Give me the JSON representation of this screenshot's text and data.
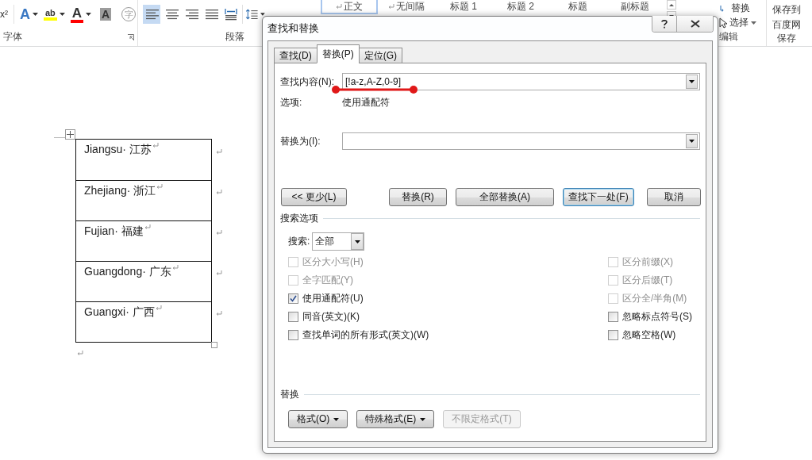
{
  "ribbon": {
    "font_group": {
      "label": "字体",
      "superscript": "x²",
      "tools": [
        {
          "kind": "text-effect",
          "glyph": "A"
        },
        {
          "kind": "highlight",
          "glyph": "ab"
        },
        {
          "kind": "font-color",
          "glyph": "A"
        },
        {
          "kind": "shading",
          "glyph": "A"
        },
        {
          "kind": "enclose",
          "glyph": "字"
        }
      ]
    },
    "paragraph_group": {
      "label": "段落",
      "tools": [
        {
          "kind": "align-left",
          "selected": true
        },
        {
          "kind": "align-center",
          "selected": false
        },
        {
          "kind": "align-right",
          "selected": false
        },
        {
          "kind": "justify",
          "selected": false
        },
        {
          "kind": "distribute",
          "selected": false
        },
        {
          "kind": "line-spacing",
          "selected": false
        }
      ]
    },
    "styles": [
      {
        "label": "正文",
        "paragraph_mark": true,
        "selected": true
      },
      {
        "label": "无间隔",
        "paragraph_mark": true,
        "selected": false
      },
      {
        "label": "标题 1",
        "paragraph_mark": false,
        "selected": false
      },
      {
        "label": "标题 2",
        "paragraph_mark": false,
        "selected": false
      },
      {
        "label": "标题",
        "paragraph_mark": false,
        "selected": false
      },
      {
        "label": "副标题",
        "paragraph_mark": false,
        "selected": false
      }
    ],
    "editing": {
      "replace": "替换",
      "select": "选择",
      "label": "编辑"
    },
    "save": {
      "line1": "保存到",
      "line2": "百度网",
      "label": "保存"
    }
  },
  "document": {
    "table": [
      {
        "text": "Jiangsu· 江苏"
      },
      {
        "text": "Zhejiang· 浙江"
      },
      {
        "text": "Fujian· 福建"
      },
      {
        "text": "Guangdong· 广东"
      },
      {
        "text": "Guangxi· 广西"
      }
    ]
  },
  "dialog": {
    "title": "查找和替换",
    "tabs": [
      {
        "label": "查找(D)",
        "selected": false
      },
      {
        "label": "替换(P)",
        "selected": true
      },
      {
        "label": "定位(G)",
        "selected": false
      }
    ],
    "find": {
      "label": "查找内容(N):",
      "value": "[!a-z,A-Z,0-9]"
    },
    "options": {
      "label": "选项:",
      "value": "使用通配符"
    },
    "replace": {
      "label": "替换为(I):"
    },
    "buttons": [
      {
        "label": "<< 更少(L)",
        "default": false
      },
      {
        "label": "替换(R)",
        "default": false
      },
      {
        "label": "全部替换(A)",
        "default": false
      },
      {
        "label": "查找下一处(F)",
        "default": true
      },
      {
        "label": "取消",
        "default": false
      }
    ],
    "search_options": {
      "title": "搜索选项",
      "search_label": "搜索:",
      "search_value": "全部",
      "left": [
        {
          "label": "区分大小写(H)",
          "checked": false,
          "disabled": true
        },
        {
          "label": "全字匹配(Y)",
          "checked": false,
          "disabled": true
        },
        {
          "label": "使用通配符(U)",
          "checked": true,
          "disabled": false
        },
        {
          "label": "同音(英文)(K)",
          "checked": false,
          "disabled": false
        },
        {
          "label": "查找单词的所有形式(英文)(W)",
          "checked": false,
          "disabled": false
        }
      ],
      "right": [
        {
          "label": "区分前缀(X)",
          "checked": false,
          "disabled": true
        },
        {
          "label": "区分后缀(T)",
          "checked": false,
          "disabled": true
        },
        {
          "label": "区分全/半角(M)",
          "checked": false,
          "disabled": true
        },
        {
          "label": "忽略标点符号(S)",
          "checked": false,
          "disabled": false
        },
        {
          "label": "忽略空格(W)",
          "checked": false,
          "disabled": false
        }
      ]
    },
    "replace_section": {
      "title": "替换",
      "buttons": [
        {
          "label": "格式(O)",
          "dropdown": true,
          "disabled": false
        },
        {
          "label": "特殊格式(E)",
          "dropdown": true,
          "disabled": false
        },
        {
          "label": "不限定格式(T)",
          "dropdown": false,
          "disabled": true
        }
      ]
    }
  }
}
